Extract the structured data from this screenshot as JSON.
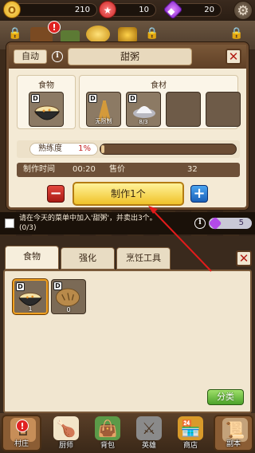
{
  "resources": {
    "coins": "210",
    "medals": "10",
    "gems": "20",
    "coin_icon": "coin-icon",
    "medal_icon": "medal-icon",
    "gem_icon": "gem-icon"
  },
  "recipe": {
    "auto_label": "自动",
    "title": "甜粥",
    "food_label": "食物",
    "ingredients_label": "食材",
    "food_badge": "D",
    "food_icon": "porridge-bowl-icon",
    "ingredients": [
      {
        "name": "wheat",
        "caption": "无限制",
        "badge": "D",
        "icon": "wheat-icon"
      },
      {
        "name": "sugar",
        "caption": "8/3",
        "badge": "D",
        "icon": "sugar-icon"
      },
      {
        "name": "",
        "caption": "",
        "badge": "",
        "icon": ""
      },
      {
        "name": "",
        "caption": "",
        "badge": "",
        "icon": ""
      }
    ],
    "proficiency_label": "熟练度",
    "proficiency_value": "1%",
    "proficiency_fraction": 0.01,
    "time_label": "制作时间",
    "time_value": "00:20",
    "price_label": "售价",
    "price_value": "32",
    "make_label": "制作1个",
    "minus_label": "−",
    "plus_label": "+"
  },
  "quest": {
    "text": "请在今天的菜单中加入'甜粥'，并卖出3个。",
    "progress": "(0/3)",
    "reward": "5"
  },
  "inventory": {
    "tabs": [
      "食物",
      "强化",
      "烹饪工具"
    ],
    "active_tab": 0,
    "items": [
      {
        "badge": "D",
        "icon": "porridge-bowl-icon",
        "count": "1",
        "selected": true
      },
      {
        "badge": "D",
        "icon": "bread-icon",
        "count": "0",
        "selected": false
      }
    ],
    "sort_label": "分类"
  },
  "nav": {
    "items": [
      {
        "label": "村庄",
        "icon": "village-icon"
      },
      {
        "label": "厨师",
        "icon": "chef-icon"
      },
      {
        "label": "背包",
        "icon": "bag-icon"
      },
      {
        "label": "英雄",
        "icon": "hero-icon"
      },
      {
        "label": "商店",
        "icon": "shop-icon"
      },
      {
        "label": "副本",
        "icon": "dungeon-icon"
      }
    ]
  },
  "colors": {
    "accent_gold": "#f0c22a",
    "alert_red": "#e02222",
    "annotation_red": "#e31b1b"
  }
}
